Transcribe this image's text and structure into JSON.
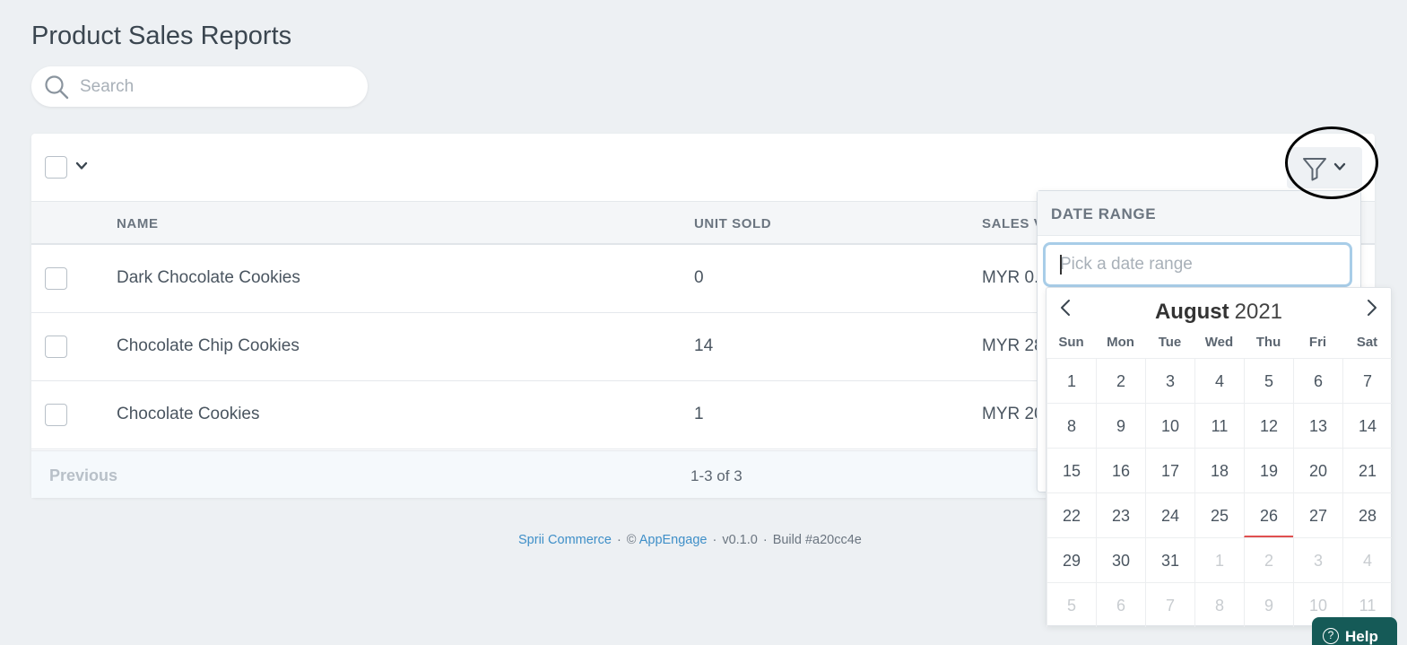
{
  "page": {
    "title": "Product Sales Reports"
  },
  "search": {
    "placeholder": "Search"
  },
  "table": {
    "columns": [
      "NAME",
      "UNIT SOLD",
      "SALES V"
    ],
    "rows": [
      {
        "name": "Dark Chocolate Cookies",
        "units": "0",
        "sales": "MYR 0."
      },
      {
        "name": "Chocolate Chip Cookies",
        "units": "14",
        "sales": "MYR 28"
      },
      {
        "name": "Chocolate Cookies",
        "units": "1",
        "sales": "MYR 20"
      }
    ]
  },
  "pager": {
    "previous": "Previous",
    "count": "1-3 of 3"
  },
  "footer": {
    "brand": "Sprii Commerce",
    "copyright": "©",
    "company": "AppEngage",
    "version": "v0.1.0",
    "build": "Build #a20cc4e"
  },
  "filter": {
    "section_title": "DATE RANGE",
    "date_placeholder": "Pick a date range"
  },
  "calendar": {
    "month": "August",
    "year": "2021",
    "weekdays": [
      "Sun",
      "Mon",
      "Tue",
      "Wed",
      "Thu",
      "Fri",
      "Sat"
    ],
    "weeks": [
      [
        "1",
        "2",
        "3",
        "4",
        "5",
        "6",
        "7"
      ],
      [
        "8",
        "9",
        "10",
        "11",
        "12",
        "13",
        "14"
      ],
      [
        "15",
        "16",
        "17",
        "18",
        "19",
        "20",
        "21"
      ],
      [
        "22",
        "23",
        "24",
        "25",
        "26",
        "27",
        "28"
      ],
      [
        "29",
        "30",
        "31",
        "1",
        "2",
        "3",
        "4"
      ],
      [
        "5",
        "6",
        "7",
        "8",
        "9",
        "10",
        "11"
      ]
    ],
    "today": "26"
  },
  "help": {
    "label": "Help",
    "icon_glyph": "?"
  },
  "icons": {
    "search": "search-icon",
    "filter": "filter-icon",
    "chevron": "chevron-down-icon",
    "prev_month": "chevron-left-icon",
    "next_month": "chevron-right-icon"
  },
  "colors": {
    "background": "#edf0f3",
    "link": "#3f8fc8",
    "help_button": "#155a57",
    "today_marker": "#e05050",
    "input_focus": "#a8cde8"
  }
}
